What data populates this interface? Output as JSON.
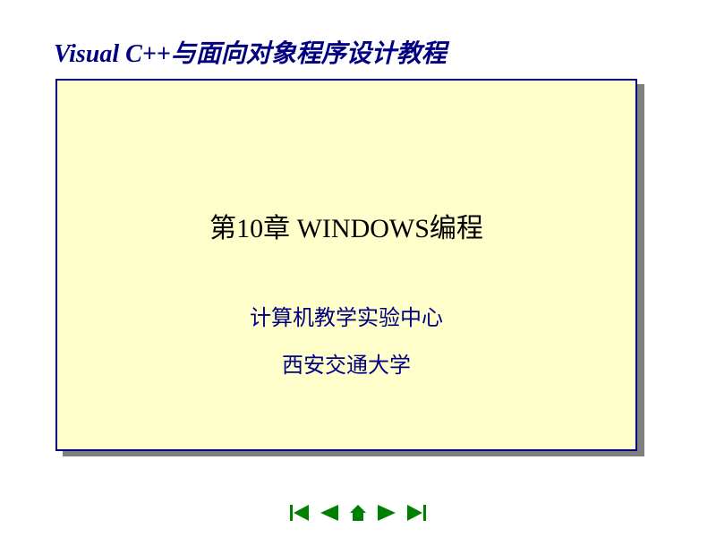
{
  "header": {
    "title": "Visual C++与面向对象程序设计教程"
  },
  "content": {
    "chapter_title": "第10章  WINDOWS编程",
    "subtitle1": "计算机教学实验中心",
    "subtitle2": "西安交通大学"
  },
  "colors": {
    "primary": "#000080",
    "background": "#ffffcc",
    "nav_button": "#008000"
  }
}
